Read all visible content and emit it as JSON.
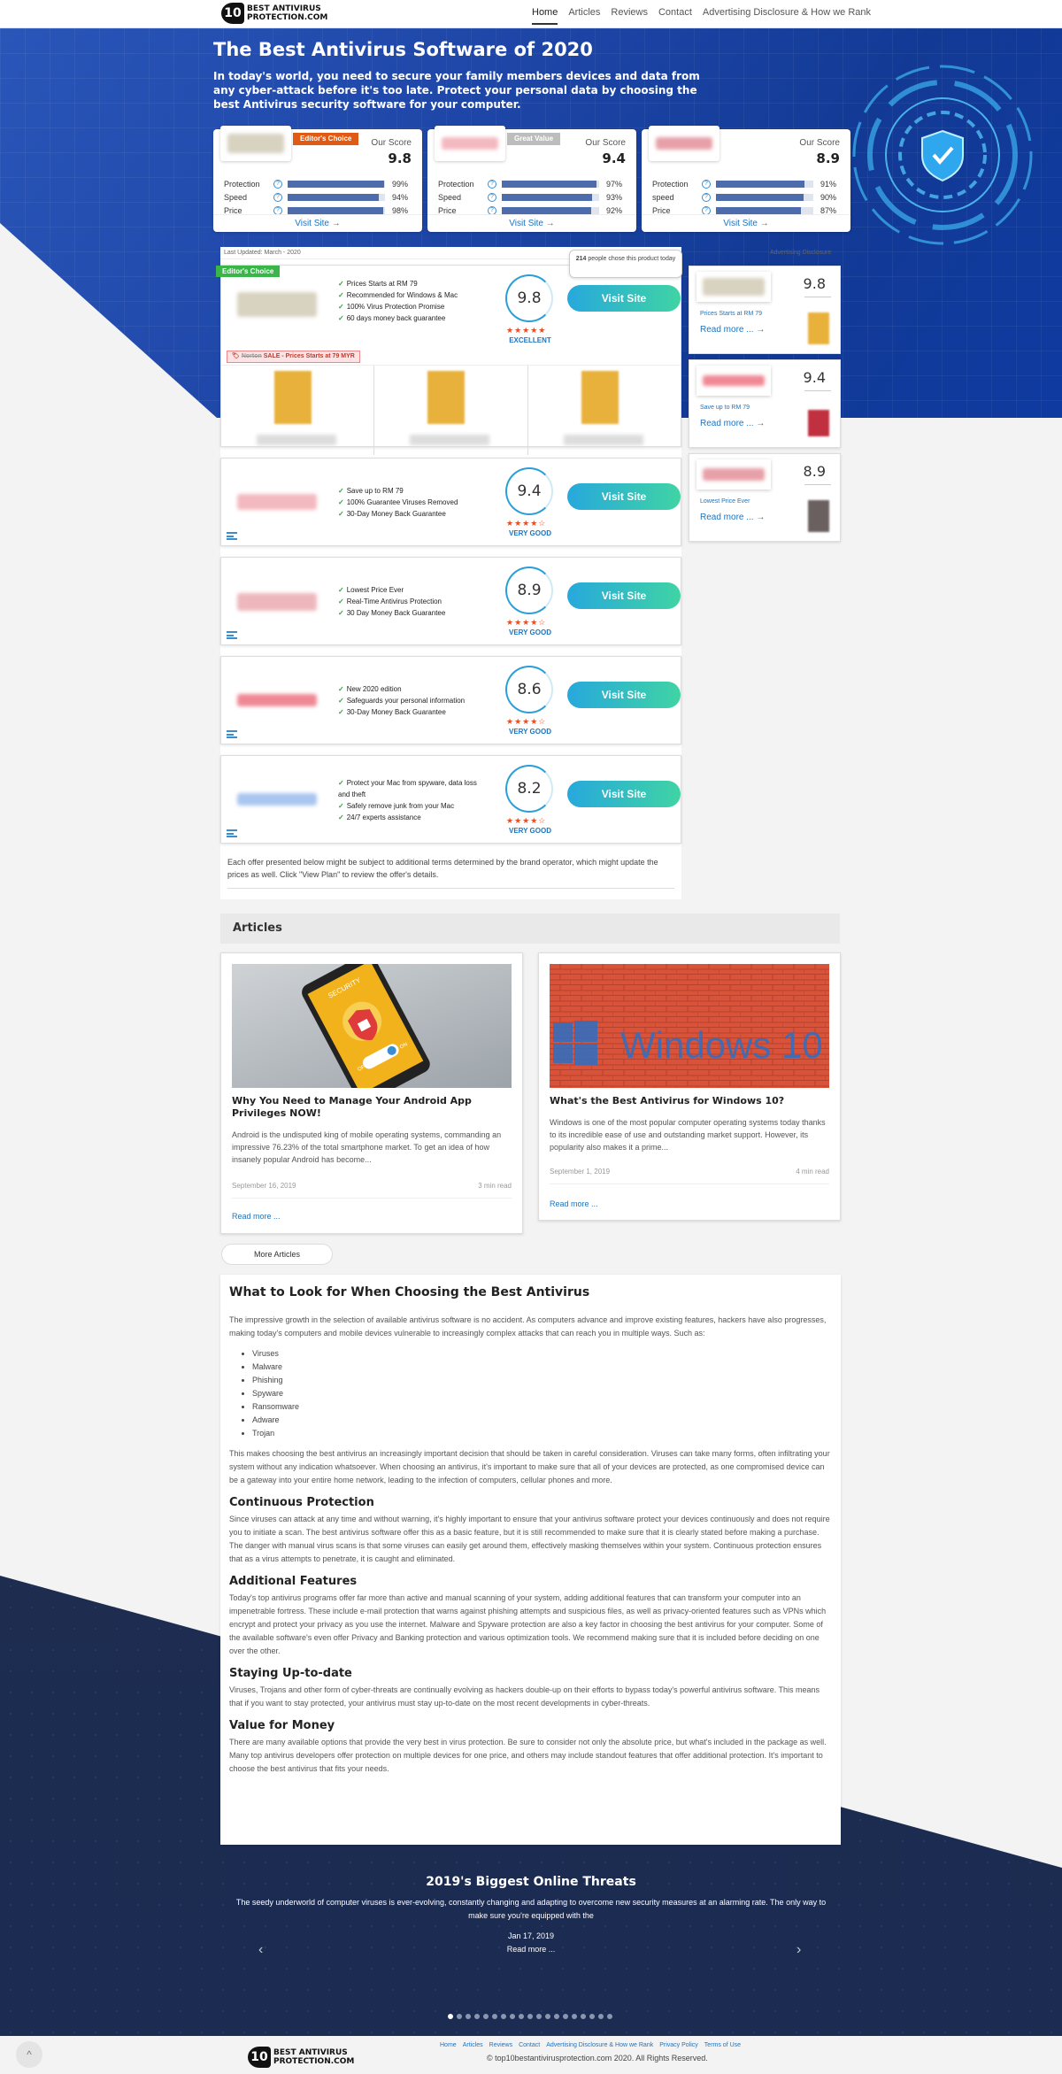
{
  "brand": {
    "logo_mark": "10",
    "logo_line1": "BEST ANTIVIRUS",
    "logo_line2": "PROTECTION.COM"
  },
  "nav": {
    "items": [
      "Home",
      "Articles",
      "Reviews",
      "Contact",
      "Advertising Disclosure & How we Rank"
    ],
    "active": "Home"
  },
  "hero": {
    "title": "The Best Antivirus Software of 2020",
    "subtitle": "In today's world, you need to secure your family members devices and data from any cyber-attack before it's too late. Protect your personal data by choosing the best Antivirus security software for your computer."
  },
  "top_cards": [
    {
      "ribbon": "Editor's Choice",
      "ribbon_color": "#e05a14",
      "score_label": "Our Score",
      "score": "9.8",
      "metrics": [
        {
          "name": "Protection",
          "value": 99,
          "label": "99%"
        },
        {
          "name": "Speed",
          "value": 94,
          "label": "94%"
        },
        {
          "name": "Price",
          "value": 98,
          "label": "98%"
        }
      ],
      "visit": "Visit Site →"
    },
    {
      "ribbon": "Great Value",
      "ribbon_color": "#bdbdbd",
      "score_label": "Our Score",
      "score": "9.4",
      "metrics": [
        {
          "name": "Protection",
          "value": 97,
          "label": "97%"
        },
        {
          "name": "Speed",
          "value": 93,
          "label": "93%"
        },
        {
          "name": "Price",
          "value": 92,
          "label": "92%"
        }
      ],
      "visit": "Visit Site →"
    },
    {
      "ribbon": "",
      "ribbon_color": "",
      "score_label": "Our Score",
      "score": "8.9",
      "metrics": [
        {
          "name": "Protection",
          "value": 91,
          "label": "91%"
        },
        {
          "name": "speed",
          "value": 90,
          "label": "90%"
        },
        {
          "name": "Price",
          "value": 87,
          "label": "87%"
        }
      ],
      "visit": "Visit Site →"
    }
  ],
  "listing": {
    "last_updated": "Last Updated: March - 2020",
    "ad_disclosure": "Advertising Disclosure",
    "editor_tag": "Editor's Choice",
    "tooltip_count": "214",
    "tooltip_text": "people chose this product today",
    "sale_old": "Norton",
    "sale_text": "SALE - Prices Starts at 79 MYR",
    "visit_label": "Visit Site",
    "offers": [
      {
        "features": [
          "Prices Starts at RM 79",
          "Recommended for Windows & Mac",
          "100% Virus Protection Promise",
          "60 days money back guarantee"
        ],
        "score": "9.8",
        "stars": "★★★★★",
        "rating": "EXCELLENT",
        "logo_color": "#d8d2c0"
      },
      {
        "features": [
          "Save up to RM 79",
          "100% Guarantee Viruses Removed",
          "30-Day Money Back Guarantee"
        ],
        "score": "9.4",
        "stars": "★★★★☆",
        "rating": "VERY GOOD",
        "logo_color": "#f3b9c0"
      },
      {
        "features": [
          "Lowest Price Ever",
          "Real-Time Antivirus Protection",
          "30 Day Money Back Guarantee"
        ],
        "score": "8.9",
        "stars": "★★★★☆",
        "rating": "VERY GOOD",
        "logo_color": "#eeb7be"
      },
      {
        "features": [
          "New 2020 edition",
          "Safeguards your personal information",
          "30-Day Money Back Guarantee"
        ],
        "score": "8.6",
        "stars": "★★★★☆",
        "rating": "VERY GOOD",
        "logo_color": "#f08894"
      },
      {
        "features": [
          "Protect your Mac from spyware, data loss and theft",
          "Safely remove junk from your Mac",
          "24/7 experts assistance"
        ],
        "score": "8.2",
        "stars": "★★★★☆",
        "rating": "VERY GOOD",
        "logo_color": "#a9c6f0"
      }
    ],
    "disclaimer": "Each offer presented below might be subject to additional terms determined by the brand operator, which might update the prices as well. Click \"View Plan\" to review the offer's details."
  },
  "sidebar": [
    {
      "score": "9.8",
      "note": "Prices Starts at RM 79",
      "read": "Read more ... →",
      "logo_color": "#d8d2c0",
      "box_color": "#e8b13c"
    },
    {
      "score": "9.4",
      "note": "Save up to RM 79",
      "read": "Read more ... →",
      "logo_color": "#f08894",
      "box_color": "#c0303f"
    },
    {
      "score": "8.9",
      "note": "Lowest Price Ever",
      "read": "Read more ... →",
      "logo_color": "#e7a0a8",
      "box_color": "#6b6060"
    }
  ],
  "articles": {
    "heading": "Articles",
    "items": [
      {
        "title": "Why You Need to Manage Your Android App Privileges NOW!",
        "excerpt": "Android is the undisputed king of mobile operating systems, commanding an impressive 76.23% of the total smartphone market. To get an idea of how insanely popular Android has become...",
        "date": "September 16, 2019",
        "read_time": "3 min read",
        "more": "Read more ...",
        "phone_text": "SECURITY",
        "toggle_off": "OFF",
        "toggle_on": "ON"
      },
      {
        "title": "What's the Best Antivirus for Windows 10?",
        "excerpt": "Windows is one of the most popular computer operating systems today thanks to its incredible ease of use and outstanding market support. However, its popularity also makes it a prime...",
        "date": "September 1, 2019",
        "read_time": "4 min read",
        "more": "Read more ...",
        "image_text": "Windows 10"
      }
    ],
    "more_button": "More Articles"
  },
  "guide": {
    "title": "What to Look for When Choosing the Best Antivirus",
    "intro": "The impressive growth in the selection of available antivirus software is no accident. As computers advance and improve existing features, hackers have also progresses, making today's computers and mobile devices vulnerable to increasingly complex attacks that can reach you in multiple ways. Such as:",
    "threats_list": [
      "Viruses",
      "Malware",
      "Phishing",
      "Spyware",
      "Ransomware",
      "Adware",
      "Trojan"
    ],
    "after_list": "This makes choosing the best antivirus an increasingly important decision that should be taken in careful consideration. Viruses can take many forms, often infiltrating your system without any indication whatsoever. When choosing an antivirus, it's important to make sure that all of your devices are protected, as one compromised device can be a gateway into your entire home network, leading to the infection of computers, cellular phones and more.",
    "sections": [
      {
        "title": "Continuous Protection",
        "text": "Since viruses can attack at any time and without warning, it's highly important to ensure that your antivirus software protect your devices continuously and does not require you to initiate a scan. The best antivirus software offer this as a basic feature, but it is still recommended to make sure that it is clearly stated before making a purchase. The danger with manual virus scans is that some viruses can easily get around them, effectively masking themselves within your system. Continuous protection ensures that as a virus attempts to penetrate, it is caught and eliminated."
      },
      {
        "title": "Additional Features",
        "text": "Today's top antivirus programs offer far more than active and manual scanning of your system, adding additional features that can transform your computer into an impenetrable fortress. These include e-mail protection that warns against phishing attempts and suspicious files, as well as privacy-oriented features such as VPNs which encrypt and protect your privacy as you use the internet. Malware and Spyware protection are also a key factor in choosing the best antivirus for your computer. Some of the available software's even offer Privacy and Banking protection and various optimization tools. We recommend making sure that it is included before deciding on one over the other."
      },
      {
        "title": "Staying Up-to-date",
        "text": "Viruses, Trojans and other form of cyber-threats are continually evolving as hackers double-up on their efforts to bypass today's powerful antivirus software. This means that if you want to stay protected, your antivirus must stay up-to-date on the most recent developments in cyber-threats."
      },
      {
        "title": "Value for Money",
        "text": "There are many available options that provide the very best in virus protection. Be sure to consider not only the absolute price, but what's included in the package as well. Many top antivirus developers offer protection on multiple devices for one price, and others may include standout features that offer additional protection. It's important to choose the best antivirus that fits your needs."
      }
    ]
  },
  "threats": {
    "title": "2019's Biggest Online Threats",
    "text": "The seedy underworld of computer viruses is ever-evolving, constantly changing and adapting to overcome new security measures at an alarming rate. The only way to make sure you're equipped with the",
    "date": "Jan 17, 2019",
    "read": "Read more ...",
    "prev": "‹",
    "next": "›",
    "slide_count": 19,
    "active_slide": 0
  },
  "footer": {
    "links": [
      "Home",
      "Articles",
      "Reviews",
      "Contact",
      "Advertising Disclosure & How we Rank",
      "Privacy Policy",
      "Terms of Use"
    ],
    "copyright": "© top10bestantivirusprotection.com 2020. All Rights Reserved.",
    "top_icon": "^"
  },
  "colors": {
    "accent": "#1e73be",
    "hero": "#1c44a5",
    "button_start": "#27a8dc",
    "button_end": "#3fd4a4",
    "stars": "#e44d26",
    "check": "#3a9b43"
  }
}
